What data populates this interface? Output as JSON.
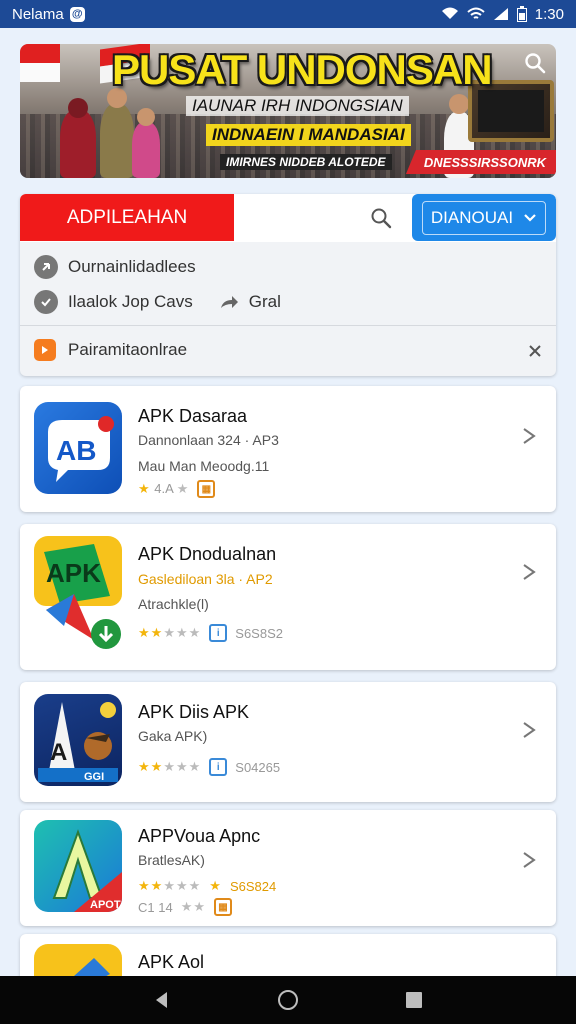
{
  "status_bar": {
    "carrier": "Nelama",
    "carrier_badge": "@",
    "time": "1:30"
  },
  "banner": {
    "title": "PUSAT UNDONSAN",
    "subtitle1": "IAUNAR IRH INDONGSIAN",
    "subtitle2": "INDNAEIN I MANDASIAI",
    "subtitle3": "IMIRNES NIDDEB ALOTEDE",
    "badge": "DNESSSIRSSONRK"
  },
  "search_panel": {
    "category_tab": "ADPILEAHAN",
    "dropdown_label": "DIANOUAI",
    "suggestions": [
      {
        "label": "Ournainlidadlees"
      },
      {
        "label": "Ilaalok Jop Cavs",
        "extra": "Gral"
      }
    ],
    "filter_label": "Pairamitaonlrae"
  },
  "apps": [
    {
      "name": "APK Dasaraa",
      "line1": "Dannonlaan 324 · AP3",
      "line2": "Mau Man Meoodg.11",
      "rating_text": "4.A"
    },
    {
      "name": "APK Dnodualnan",
      "line1": "Gaslediloan 3la · AP2",
      "line2": "Atrachkle(l)",
      "rating_text": "S6S8S2"
    },
    {
      "name": "APK Diis APK",
      "line1": "Gaka APK)",
      "rating_text": "S04265"
    },
    {
      "name": "APPVoua Apnc",
      "line1": "BratlesAK)",
      "rating_text": "S6S824",
      "line3": "C1 14"
    },
    {
      "name": "APK Aol"
    }
  ],
  "icons": {
    "app1": "ab-bubble-icon",
    "app2": "apk-download-icon",
    "app3": "rocket-icon",
    "app4": "a-letter-icon",
    "app5": "apk-icon"
  },
  "colors": {
    "status_bar": "#1d4a96",
    "accent_red": "#f01a1a",
    "accent_blue": "#1e88e8",
    "star": "#f3b50c"
  }
}
